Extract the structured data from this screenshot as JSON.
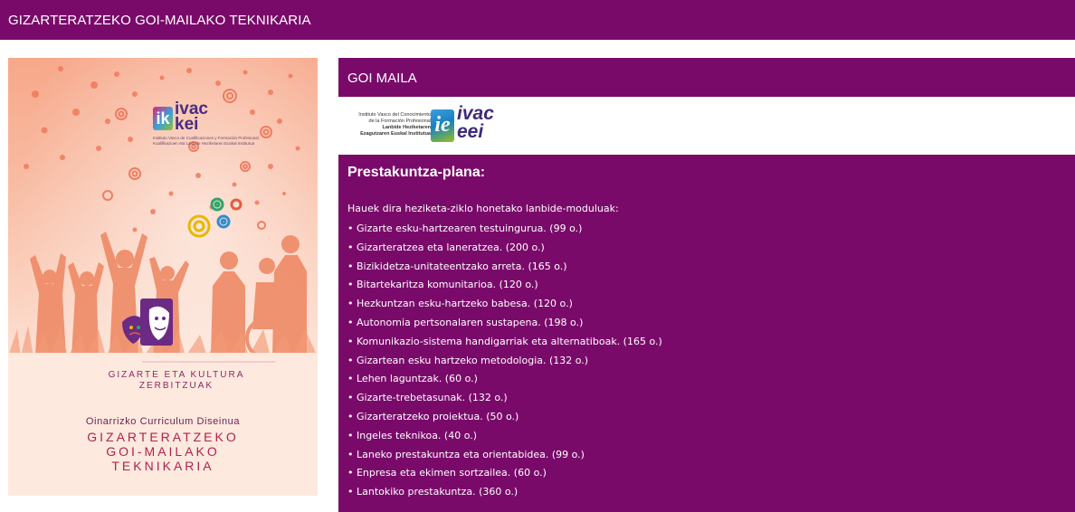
{
  "header": {
    "title": "GIZARTERATZEKO GOI-MAILAKO TEKNIKARIA"
  },
  "cover": {
    "logo_ik": "ik",
    "logo_line1": "ivac",
    "logo_line2": "kei",
    "logo_small": "Instituto Vasco de Cualificaciones y Formación Profesional Kualifikazioen eta Lanbide Heziketaren Euskal Institutua",
    "category_line1": "GIZARTE ETA KULTURA",
    "category_line2": "ZERBITZUAK",
    "curriculum": "Oinarrizko Curriculum Diseinua",
    "title_line1": "GIZARTERATZEKO",
    "title_line2": "GOI-MAILAKO",
    "title_line3": "TEKNIKARIA"
  },
  "level": {
    "title": "GOI MAILA"
  },
  "institute": {
    "line1": "Instituto Vasco del Conocimiento",
    "line2": "de la Formación Profesional",
    "line3": "Lanbide Heziketaren",
    "line4": "Ezagutzaren Euskal Institutua",
    "mark": "ie",
    "word1": "ivac",
    "word2": "eei"
  },
  "plan": {
    "heading": "Prestakuntza-plana:",
    "intro": "Hauek dira heziketa-ziklo honetako lanbide-moduluak:",
    "modules": [
      "• Gizarte esku-hartzearen testuingurua. (99 o.)",
      "• Gizarteratzea eta laneratzea. (200 o.)",
      "• Bizikidetza-unitateentzako arreta. (165 o.)",
      "• Bitartekaritza komunitarioa. (120 o.)",
      "• Hezkuntzan esku-hartzeko babesa. (120 o.)",
      "• Autonomia pertsonalaren sustapena. (198 o.)",
      "• Komunikazio-sistema handigarriak eta alternatiboak. (165 o.)",
      "• Gizartean esku hartzeko metodologia. (132 o.)",
      "• Lehen laguntzak. (60 o.)",
      "• Gizarte-trebetasunak. (132 o.)",
      "• Gizarteratzeko proiektua. (50 o.)",
      "• Ingeles teknikoa. (40 o.)",
      "• Laneko prestakuntza eta orientabidea. (99 o.)",
      "• Enpresa eta ekimen sortzailea. (60 o.)",
      "• Lantokiko prestakuntza. (360 o.)"
    ]
  },
  "colors": {
    "brand": "#7a0a6a",
    "cover_title": "#b4204e"
  }
}
